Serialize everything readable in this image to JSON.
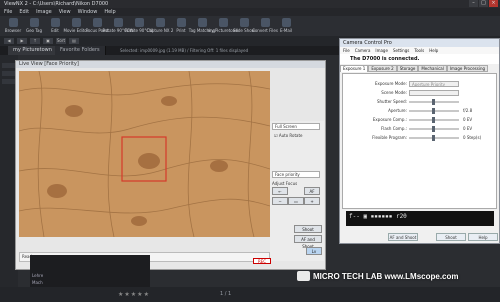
{
  "app": {
    "title": "ViewNX 2 - C:\\Users\\Richard\\Nikon D7000",
    "menu": [
      "File",
      "Edit",
      "Image",
      "View",
      "Window",
      "Help"
    ],
    "toolbar": [
      "Browser",
      "Geo Tag",
      "Edit",
      "Movie Editor",
      "Focus Point",
      "Rotate 90°CCW",
      "Rotate 90°CW",
      "Capture NX 2",
      "Print",
      "Tag Matching",
      "my Picturetown",
      "Slide Show",
      "Convert Files",
      "E-Mail"
    ],
    "nav": [
      "◀",
      "▶",
      "↑",
      "▣",
      "Sort",
      "▤"
    ],
    "tabs": [
      "my Picturetown",
      "Favorite Folders"
    ],
    "selection_info": "Selected: imp0009.jpg (1.19 MB) / Filtering Off: 1 files displayed"
  },
  "liveview": {
    "title": "Live View [Face Priority]",
    "side_options": [
      "Full Screen",
      "Auto Rotate",
      "Face priority"
    ],
    "adjust_focus_label": "Adjust Focus",
    "focus_buttons": [
      "←",
      "AF"
    ],
    "buttons": [
      "Shoot",
      "AF and Shoot",
      "Lv"
    ],
    "status_text": "Ready",
    "rec_label": "REC"
  },
  "camera_control": {
    "title": "Camera Control Pro",
    "menu": [
      "File",
      "Camera",
      "Image",
      "Settings",
      "Tools",
      "Help"
    ],
    "connected_text": "The D7000 is connected.",
    "tabs": [
      "Exposure 1",
      "Exposure 2",
      "Storage",
      "Mechanical",
      "Image Processing"
    ],
    "settings": [
      {
        "label": "Exposure Mode:",
        "value": "Aperture Priority",
        "display": "select"
      },
      {
        "label": "Scene Mode:",
        "value": "",
        "display": "select"
      },
      {
        "label": "Shutter Speed:",
        "value": "",
        "display": "slider"
      },
      {
        "label": "Aperture:",
        "value": "f/2.8",
        "display": "slider"
      },
      {
        "label": "Exposure Comp.:",
        "value": "0 EV",
        "display": "slider"
      },
      {
        "label": "Flash Comp.:",
        "value": "0 EV",
        "display": "slider"
      },
      {
        "label": "Flexible Program:",
        "value": "0 Step(s)",
        "display": "slider"
      }
    ],
    "lcd_readout": "f-- ▣ ▪▪▪▪▪▪ r20",
    "buttons": [
      "AF and Shoot",
      "Shoot",
      "Help"
    ]
  },
  "thumbnails": [
    "Lehre",
    "Mach"
  ],
  "bottom": {
    "page_indicator": "1 / 1",
    "watermark": "MICRO TECH LAB  www.LMscope.com"
  }
}
